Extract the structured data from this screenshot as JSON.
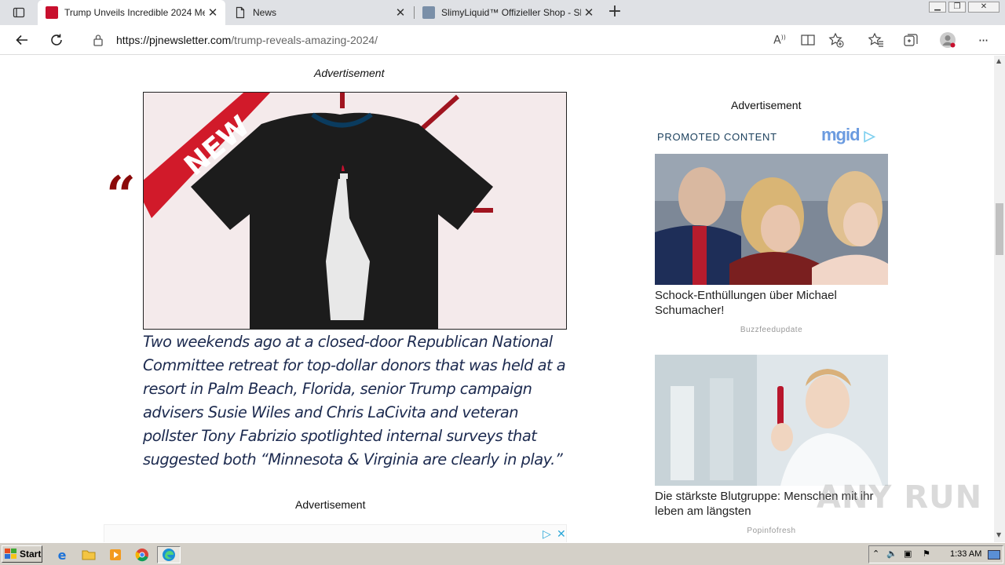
{
  "browser": {
    "tabs": [
      {
        "title": "Trump Unveils Incredible 2024 Me",
        "active": true
      },
      {
        "title": "News",
        "active": false
      },
      {
        "title": "SlimyLiquid™ Offizieller Shop - Sl",
        "active": false
      }
    ],
    "url_domain": "https://pjnewsletter.com",
    "url_path": "/trump-reveals-amazing-2024/",
    "colors": {
      "tabbar": "#dfe1e5",
      "accent": "#0078d4"
    }
  },
  "main": {
    "ad_label_top": "Advertisement",
    "hero_banner": "NEW",
    "quote_mark": "“",
    "article_text": "Two weekends ago at a closed-door Republican National Committee retreat for top-dollar donors that was held at a resort in Palm Beach, Florida, senior Trump campaign advisers Susie Wiles and Chris LaCivita and veteran pollster Tony Fabrizio spotlighted internal surveys that suggested both “Minnesota & Virginia are clearly in play.”",
    "ad_label_bottom": "Advertisement"
  },
  "sidebar": {
    "ad_label": "Advertisement",
    "promo_label": "PROMOTED CONTENT",
    "brand": "mgid",
    "cards": [
      {
        "title": "Schock-Enthüllungen über Michael Schumacher!",
        "source": "Buzzfeedupdate"
      },
      {
        "title": "Die stärkste Blutgruppe: Menschen mit ihr leben am längsten",
        "source": "Popinfofresh"
      }
    ]
  },
  "watermark": "ANY RUN",
  "taskbar": {
    "start_label": "Start",
    "clock": "1:33 AM"
  }
}
